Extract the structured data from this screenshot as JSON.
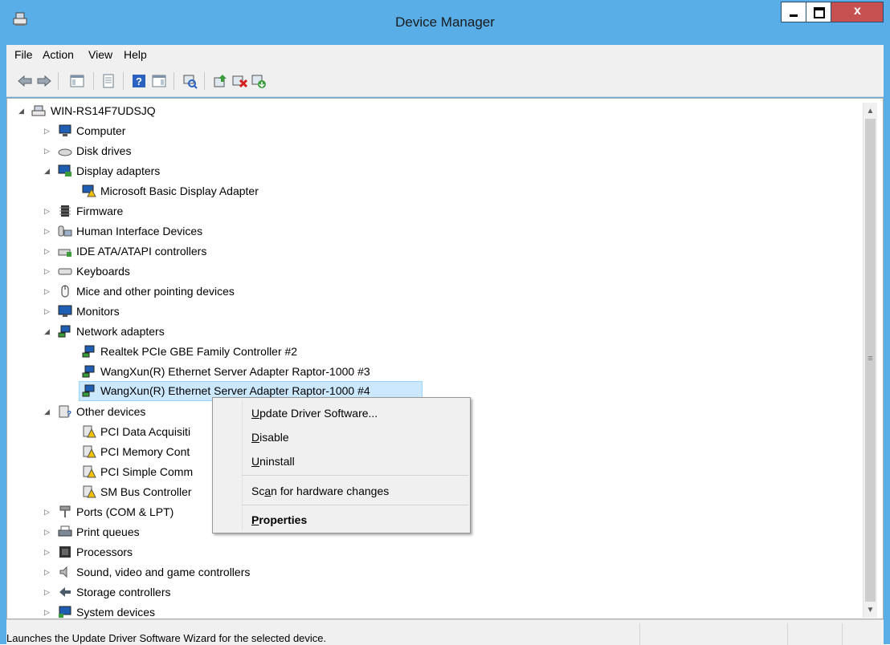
{
  "window": {
    "title": "Device Manager",
    "close_label": "x"
  },
  "menu": {
    "file": "File",
    "action": "Action",
    "view": "View",
    "help": "Help"
  },
  "tree": {
    "root": "WIN-RS14F7UDSJQ",
    "items": [
      {
        "label": "Computer",
        "expanded": false
      },
      {
        "label": "Disk drives",
        "expanded": false
      },
      {
        "label": "Display adapters",
        "expanded": true
      },
      {
        "label": "Microsoft Basic Display Adapter",
        "child": true
      },
      {
        "label": "Firmware",
        "expanded": false
      },
      {
        "label": "Human Interface Devices",
        "expanded": false
      },
      {
        "label": "IDE ATA/ATAPI controllers",
        "expanded": false
      },
      {
        "label": "Keyboards",
        "expanded": false
      },
      {
        "label": "Mice and other pointing devices",
        "expanded": false
      },
      {
        "label": "Monitors",
        "expanded": false
      },
      {
        "label": "Network adapters",
        "expanded": true
      },
      {
        "label": "Realtek PCIe GBE Family Controller #2",
        "child": true
      },
      {
        "label": "WangXun(R) Ethernet Server Adapter Raptor-1000 #3",
        "child": true
      },
      {
        "label": "WangXun(R) Ethernet Server Adapter Raptor-1000 #4",
        "child": true,
        "selected": true
      },
      {
        "label": "Other devices",
        "expanded": true
      },
      {
        "label": "PCI Data Acquisiti",
        "child": true
      },
      {
        "label": "PCI Memory Cont",
        "child": true
      },
      {
        "label": "PCI Simple Comm",
        "child": true
      },
      {
        "label": "SM Bus Controller",
        "child": true
      },
      {
        "label": "Ports (COM & LPT)",
        "expanded": false
      },
      {
        "label": "Print queues",
        "expanded": false
      },
      {
        "label": "Processors",
        "expanded": false
      },
      {
        "label": "Sound, video and game controllers",
        "expanded": false
      },
      {
        "label": "Storage controllers",
        "expanded": false
      },
      {
        "label": "System devices",
        "expanded": false
      }
    ]
  },
  "context_menu": {
    "update": {
      "pre": "",
      "key": "U",
      "post": "pdate Driver Software..."
    },
    "disable": {
      "pre": "",
      "key": "D",
      "post": "isable"
    },
    "uninstall": {
      "pre": "",
      "key": "U",
      "post": "ninstall"
    },
    "scan": {
      "pre": "Sc",
      "key": "a",
      "post": "n for hardware changes"
    },
    "properties": {
      "pre": "",
      "key": "P",
      "post": "roperties"
    }
  },
  "status": {
    "text": "Launches the Update Driver Software Wizard for the selected device."
  },
  "colors": {
    "titlebar": "#5aaee8",
    "close_button": "#c75050",
    "selection": "#cce8ff"
  }
}
